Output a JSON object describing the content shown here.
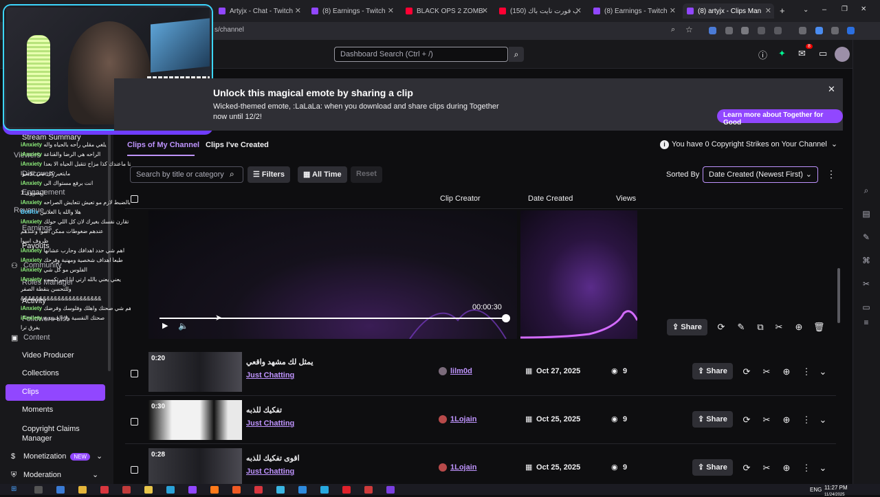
{
  "browser": {
    "tabs": [
      {
        "title": "Artyjx - Chat - Twitch",
        "favicon_color": "#9147ff"
      },
      {
        "title": "(8) Earnings - Twitch",
        "favicon_color": "#9147ff"
      },
      {
        "title": "BLACK OPS 2 ZOMBIES: C",
        "favicon_color": "#ff0033"
      },
      {
        "title": "(150) مقلب فورت نايت بأك",
        "favicon_color": "#ff0033"
      },
      {
        "title": "(8) Earnings - Twitch",
        "favicon_color": "#9147ff"
      },
      {
        "title": "(8) artyjx - Clips Manager",
        "favicon_color": "#9147ff"
      }
    ],
    "new_tab_label": "+",
    "url": "s/channel",
    "window_controls": [
      "⌄",
      "–",
      "❐",
      "✕"
    ]
  },
  "topnav": {
    "search_placeholder": "Dashboard Search (Ctrl + /)",
    "notification_count": "8"
  },
  "sidebar": {
    "items": [
      {
        "label": "Stream Summary"
      },
      {
        "label": "Viewers"
      },
      {
        "label": "Discovery"
      },
      {
        "label": "Engagement"
      },
      {
        "label": "Revenue"
      },
      {
        "label": "Earnings"
      },
      {
        "label": "Payouts"
      },
      {
        "label": "Community"
      },
      {
        "label": "Roles Manager"
      },
      {
        "label": "Activity"
      },
      {
        "label": "Followers List"
      },
      {
        "label": "Content"
      },
      {
        "label": "Video Producer"
      },
      {
        "label": "Collections"
      },
      {
        "label": "Clips"
      },
      {
        "label": "Moments"
      },
      {
        "label": "Copyright Claims Manager"
      },
      {
        "label": "Monetization",
        "badge": "NEW"
      },
      {
        "label": "Moderation"
      }
    ]
  },
  "chat": [
    {
      "user": "iAnxiety",
      "msg": "يلغي مقلي راحه بالحياه واله"
    },
    {
      "user": "iAnxiety",
      "msg": "الراحه هي الرضا والقناعة"
    },
    {
      "user": "iAnxiety",
      "msg": "انتا ماعندك كذا مزاح تتقبل الحياه الا بعدا"
    },
    {
      "user": "",
      "msg": "مايتغير كل شي للاسوا"
    },
    {
      "user": "iAnxiety",
      "msg": "انت برفع مستواك الى"
    },
    {
      "user": "",
      "msg": "المستوى 1"
    },
    {
      "user": "iAnxiety",
      "msg": "بالضبط لازم مو تعيش تتعايش الصراحه"
    },
    {
      "user": "BotRix",
      "msg": "هلا والله يا الغلاتين"
    },
    {
      "user": "iAnxiety",
      "msg": "لا تقارن نفسك بغيرك لان كل اللي حولك"
    },
    {
      "user": "",
      "msg": "عندهم ضغوطات ممكن اسوأ وعندهم"
    },
    {
      "user": "",
      "msg": "ظروف اسوأ"
    },
    {
      "user": "iAnxiety",
      "msg": "اهم شي حدد اهدافك وحارب عشانها"
    },
    {
      "user": "iAnxiety",
      "msg": "طبعاً اهداف شخصية ومهنية وفرحك"
    },
    {
      "user": "iAnxiety",
      "msg": "الفلوس مو كل شي"
    },
    {
      "user": "iAnxiety",
      "msg": "يعني يعني بالله ارتي انا اتمرتكست"
    },
    {
      "user": "",
      "msg": "وللتحسن بنقطة الصفر"
    },
    {
      "user": "",
      "msg": "&&&&&&&&&&&&&&&&&&&&&&"
    },
    {
      "user": "iAnxiety",
      "msg": "اهم شي صحتك واهلك وفلوسك وفرضك"
    },
    {
      "user": "iAnxiety",
      "msg": "صحتك النفسية ولا الجسدية"
    },
    {
      "user": "",
      "msg": "يفرق ترا"
    }
  ],
  "banner": {
    "title": "Unlock this magical emote by sharing a clip",
    "description": "Wicked-themed emote, :LaLaLa: when you download and share clips during Together now until 12/2!",
    "button": "Learn more about Together for Good"
  },
  "clips": {
    "tabs": [
      "Clips of My Channel",
      "Clips I've Created"
    ],
    "strikes_text": "You have 0 Copyright Strikes on Your Channel",
    "search_placeholder": "Search by title or category",
    "filters_label": "Filters",
    "time_label": "All Time",
    "reset_label": "Reset",
    "sorted_by_label": "Sorted By",
    "sort_value": "Date Created (Newest First)",
    "columns": [
      "Clip Creator",
      "Date Created",
      "Views"
    ],
    "player": {
      "time": "00:00:30",
      "progress": 1.0,
      "share_label": "Share"
    },
    "rows": [
      {
        "duration": "0:20",
        "title": "يمثل لك مشهد واقعي",
        "category": "Just Chatting",
        "creator": "lilm0d",
        "date": "Oct 27, 2025",
        "views": "9",
        "share": "Share"
      },
      {
        "duration": "0:30",
        "title": "تفكيك للذبه",
        "category": "Just Chatting",
        "creator": "1Lojain",
        "date": "Oct 25, 2025",
        "views": "9",
        "share": "Share"
      },
      {
        "duration": "0:28",
        "title": "اقوى تفكيك للذبه",
        "category": "Just Chatting",
        "creator": "1Lojain",
        "date": "Oct 25, 2025",
        "views": "9",
        "share": "Share"
      }
    ]
  },
  "taskbar": {
    "language": "ENG",
    "time": "11:27 PM",
    "date": "11/24/2025"
  }
}
